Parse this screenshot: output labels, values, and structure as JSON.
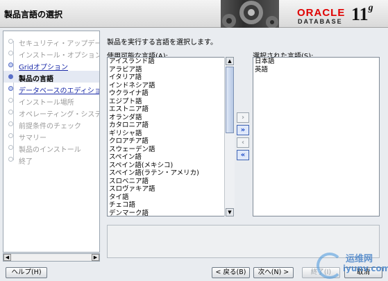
{
  "window": {
    "title": "製品言語の選択"
  },
  "branding": {
    "oracle": "ORACLE",
    "database": "DATABASE",
    "version": "11",
    "version_suffix": "g"
  },
  "nav": {
    "items": [
      {
        "label": "セキュリティ・アップデートの",
        "state": "done"
      },
      {
        "label": "インストール・オプション",
        "state": "done"
      },
      {
        "label": "Gridオプション",
        "state": "link"
      },
      {
        "label": "製品の言語",
        "state": "current"
      },
      {
        "label": "データベースのエディション",
        "state": "link"
      },
      {
        "label": "インストール場所",
        "state": "pending"
      },
      {
        "label": "オペレーティング・システム・",
        "state": "pending"
      },
      {
        "label": "前提条件のチェック",
        "state": "pending"
      },
      {
        "label": "サマリー",
        "state": "pending"
      },
      {
        "label": "製品のインストール",
        "state": "pending"
      },
      {
        "label": "終了",
        "state": "pending"
      }
    ]
  },
  "content": {
    "instruction": "製品を実行する言語を選択します。",
    "available_label": "使用可能な言語(A):",
    "available_label_key": "A",
    "selected_label": "選択された言語(S):",
    "selected_label_key": "S",
    "available_languages": [
      "アイスランド語",
      "アラビア語",
      "イタリア語",
      "インドネシア語",
      "ウクライナ語",
      "エジプト語",
      "エストニア語",
      "オランダ語",
      "カタロニア語",
      "ギリシャ語",
      "クロアチア語",
      "スウェーデン語",
      "スペイン語",
      "スペイン語(メキシコ)",
      "スペイン語(ラテン・アメリカ)",
      "スロベニア語",
      "スロヴァキア語",
      "タイ語",
      "チェコ語",
      "デンマーク語"
    ],
    "selected_languages": [
      "日本語",
      "英語"
    ],
    "move_buttons": [
      "›",
      "»",
      "‹",
      "«"
    ]
  },
  "buttons": {
    "help": "ヘルプ(H)",
    "back": "< 戻る(B)",
    "next": "次へ(N) >",
    "install": "終了(I)",
    "cancel": "取消"
  },
  "watermark": {
    "text1": "运维网",
    "text2": "iyunv.com"
  }
}
